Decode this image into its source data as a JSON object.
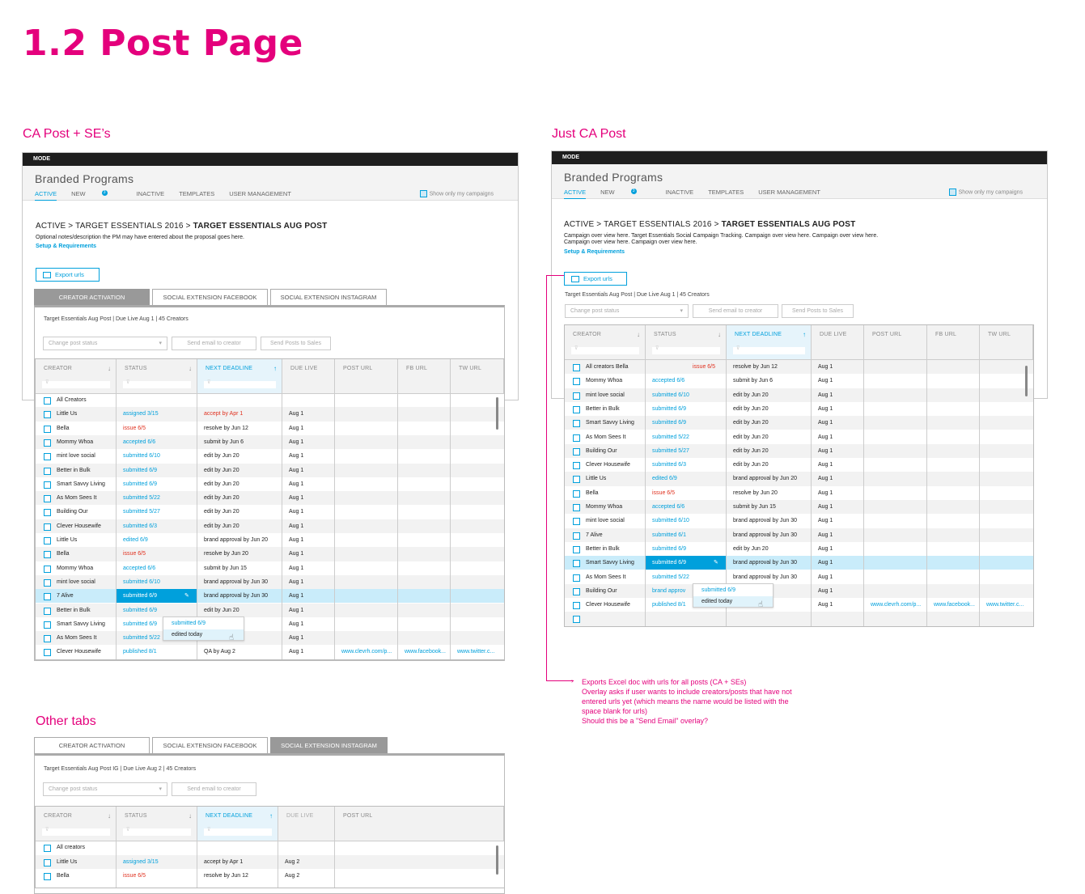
{
  "page_title": "1.2 Post Page",
  "sections": {
    "ca_se": "CA Post + SE’s",
    "just_ca": "Just CA Post",
    "other_tabs": "Other tabs"
  },
  "app": {
    "mode": "MODE",
    "title": "Branded Programs",
    "nav": [
      "ACTIVE",
      "NEW",
      "INACTIVE",
      "TEMPLATES",
      "USER MANAGEMENT"
    ],
    "nav_badge": "3",
    "show_only": "Show only my campaigns"
  },
  "left": {
    "crumb_prefix": "ACTIVE > TARGET ESSENTIALS 2016 > ",
    "crumb_bold": "TARGET ESSENTIALS AUG POST",
    "notes": "Optional notes/description the PM may have entered about the proposal goes here.",
    "setup_link": "Setup & Requirements",
    "export": "Export urls",
    "tabs": [
      "CREATOR ACTIVATION",
      "SOCIAL EXTENSION FACEBOOK",
      "SOCIAL EXTENSION INSTAGRAM"
    ],
    "meta": "Target Essentials Aug Post   |   Due Live Aug 1   |   45 Creators",
    "change_status": "Change post status",
    "send_email": "Send email to creator",
    "send_posts": "Send Posts to Sales",
    "headers": [
      "CREATOR",
      "STATUS",
      "NEXT DEADLINE",
      "DUE LIVE",
      "POST URL",
      "FB URL",
      "TW URL"
    ],
    "rows": [
      {
        "creator": "All Creators",
        "status": "",
        "deadline": "",
        "due": "",
        "post": "",
        "fb": "",
        "tw": ""
      },
      {
        "creator": "Little Us",
        "status": "assigned 3/15",
        "deadline": "accept by Apr 1",
        "due": "Aug 1",
        "post": "",
        "fb": "",
        "tw": ""
      },
      {
        "creator": "Bella",
        "status": "issue 6/5",
        "deadline": "resolve by Jun 12",
        "due": "Aug 1",
        "post": "",
        "fb": "",
        "tw": ""
      },
      {
        "creator": "Mommy Whoa",
        "status": "accepted 6/6",
        "deadline": "submit by Jun 6",
        "due": "Aug 1",
        "post": "",
        "fb": "",
        "tw": ""
      },
      {
        "creator": "mint love social",
        "status": "submitted 6/10",
        "deadline": "edit by Jun 20",
        "due": "Aug 1",
        "post": "",
        "fb": "",
        "tw": ""
      },
      {
        "creator": "Better in Bulk",
        "status": "submitted 6/9",
        "deadline": "edit by Jun 20",
        "due": "Aug 1",
        "post": "",
        "fb": "",
        "tw": ""
      },
      {
        "creator": "Smart Savvy Living",
        "status": "submitted 6/9",
        "deadline": "edit by Jun 20",
        "due": "Aug 1",
        "post": "",
        "fb": "",
        "tw": ""
      },
      {
        "creator": "As Mom Sees It",
        "status": "submitted 5/22",
        "deadline": "edit by Jun 20",
        "due": "Aug 1",
        "post": "",
        "fb": "",
        "tw": ""
      },
      {
        "creator": "Building Our",
        "status": "submitted 5/27",
        "deadline": "edit by Jun 20",
        "due": "Aug 1",
        "post": "",
        "fb": "",
        "tw": ""
      },
      {
        "creator": "Clever Housewife",
        "status": "submitted 6/3",
        "deadline": "edit by Jun 20",
        "due": "Aug 1",
        "post": "",
        "fb": "",
        "tw": ""
      },
      {
        "creator": "Little Us",
        "status": "edited 6/9",
        "deadline": "brand approval by Jun 20",
        "due": "Aug 1",
        "post": "",
        "fb": "",
        "tw": ""
      },
      {
        "creator": "Bella",
        "status": "issue 6/5",
        "deadline": "resolve by Jun 20",
        "due": "Aug 1",
        "post": "",
        "fb": "",
        "tw": ""
      },
      {
        "creator": "Mommy Whoa",
        "status": "accepted 6/6",
        "deadline": "submit by Jun 15",
        "due": "Aug 1",
        "post": "",
        "fb": "",
        "tw": ""
      },
      {
        "creator": "mint love social",
        "status": "submitted 6/10",
        "deadline": "brand approval by Jun 30",
        "due": "Aug 1",
        "post": "",
        "fb": "",
        "tw": ""
      },
      {
        "creator": "7 Alive",
        "status": "submitted 6/9",
        "deadline": "brand approval by Jun 30",
        "due": "Aug 1",
        "post": "",
        "fb": "",
        "tw": ""
      },
      {
        "creator": "Better in Bulk",
        "status": "submitted 6/9",
        "deadline": "edit by Jun 20",
        "due": "Aug 1",
        "post": "",
        "fb": "",
        "tw": ""
      },
      {
        "creator": "Smart Savvy Living",
        "status": "submitted 6/9",
        "deadline": "l by Jun 30",
        "due": "Aug 1",
        "post": "",
        "fb": "",
        "tw": ""
      },
      {
        "creator": "As Mom Sees It",
        "status": "submitted 5/22",
        "deadline": "l by Jun 30",
        "due": "Aug 1",
        "post": "",
        "fb": "",
        "tw": ""
      },
      {
        "creator": "Clever Housewife",
        "status": "published 8/1",
        "deadline": "QA by Aug 2",
        "due": "Aug 1",
        "post": "www.clevrh.com/p...",
        "fb": "www.facebook...",
        "tw": "www.twitter.c..."
      }
    ],
    "popup": {
      "item1": "submitted 6/9",
      "item2": "edited today"
    }
  },
  "right": {
    "crumb_prefix": "ACTIVE > TARGET ESSENTIALS 2016 > ",
    "crumb_bold": "TARGET ESSENTIALS AUG POST",
    "overview1": "Campaign over view here. Target Essentials Social Campaign Tracking. Campaign over view here. Campaign over view here.",
    "overview2": "Campaign over view here. Campaign over view here.",
    "setup_link": "Setup & Requirements",
    "export": "Export urls",
    "meta": "Target Essentials Aug Post   |   Due Live Aug 1   |   45 Creators",
    "change_status": "Change post status",
    "send_email": "Send email to creator",
    "send_posts": "Send Posts to Sales",
    "headers": [
      "CREATOR",
      "STATUS",
      "NEXT DEADLINE",
      "DUE LIVE",
      "POST URL",
      "FB URL",
      "TW URL"
    ],
    "rows": [
      {
        "creator": "All creators    Bella",
        "status": "",
        "statusover": "issue 6/5",
        "deadline": "resolve by Jun 12",
        "due": "Aug 1",
        "post": "",
        "fb": "",
        "tw": ""
      },
      {
        "creator": "Mommy Whoa",
        "status": "accepted 6/6",
        "deadline": "submit by Jun 6",
        "due": "Aug 1",
        "post": "",
        "fb": "",
        "tw": ""
      },
      {
        "creator": "mint love social",
        "status": "submitted 6/10",
        "deadline": "edit by Jun 20",
        "due": "Aug 1",
        "post": "",
        "fb": "",
        "tw": ""
      },
      {
        "creator": "Better in Bulk",
        "status": "submitted 6/9",
        "deadline": "edit by Jun 20",
        "due": "Aug 1",
        "post": "",
        "fb": "",
        "tw": ""
      },
      {
        "creator": "Smart Savvy Living",
        "status": "submitted 6/9",
        "deadline": "edit by Jun 20",
        "due": "Aug 1",
        "post": "",
        "fb": "",
        "tw": ""
      },
      {
        "creator": "As Mom Sees It",
        "status": "submitted 5/22",
        "deadline": "edit by Jun 20",
        "due": "Aug 1",
        "post": "",
        "fb": "",
        "tw": ""
      },
      {
        "creator": "Building Our",
        "status": "submitted 5/27",
        "deadline": "edit by Jun 20",
        "due": "Aug 1",
        "post": "",
        "fb": "",
        "tw": ""
      },
      {
        "creator": "Clever Housewife",
        "status": "submitted 6/3",
        "deadline": "edit by Jun 20",
        "due": "Aug 1",
        "post": "",
        "fb": "",
        "tw": ""
      },
      {
        "creator": "Little Us",
        "status": "edited 6/9",
        "deadline": "brand approval by Jun 20",
        "due": "Aug 1",
        "post": "",
        "fb": "",
        "tw": ""
      },
      {
        "creator": "Bella",
        "status": "issue 6/5",
        "deadline": "resolve by Jun 20",
        "due": "Aug 1",
        "post": "",
        "fb": "",
        "tw": ""
      },
      {
        "creator": "Mommy Whoa",
        "status": "accepted 6/6",
        "deadline": "submit by Jun 15",
        "due": "Aug 1",
        "post": "",
        "fb": "",
        "tw": ""
      },
      {
        "creator": "mint love social",
        "status": "submitted 6/10",
        "deadline": "brand approval by Jun 30",
        "due": "Aug 1",
        "post": "",
        "fb": "",
        "tw": ""
      },
      {
        "creator": "7 Alive",
        "status": "submitted 6/1",
        "deadline": "brand approval by Jun 30",
        "due": "Aug 1",
        "post": "",
        "fb": "",
        "tw": ""
      },
      {
        "creator": "Better in Bulk",
        "status": "submitted 6/9",
        "deadline": "edit by Jun 20",
        "due": "Aug 1",
        "post": "",
        "fb": "",
        "tw": ""
      },
      {
        "creator": "Smart Savvy Living",
        "status": "submitted 6/9",
        "deadline": "brand approval by Jun 30",
        "due": "Aug 1",
        "post": "",
        "fb": "",
        "tw": ""
      },
      {
        "creator": "As Mom Sees It",
        "status": "submitted 5/22",
        "deadline": "brand approval by Jun 30",
        "due": "Aug 1",
        "post": "",
        "fb": "",
        "tw": ""
      },
      {
        "creator": "Building Our",
        "status": "brand approv",
        "deadline": "1",
        "due": "Aug 1",
        "post": "",
        "fb": "",
        "tw": ""
      },
      {
        "creator": "Clever Housewife",
        "status": "published 8/1",
        "deadline": "",
        "due": "Aug 1",
        "post": "www.clevrh.com/p...",
        "fb": "www.facebook...",
        "tw": "www.twitter.c..."
      },
      {
        "creator": "",
        "status": "",
        "deadline": "",
        "due": "",
        "post": "",
        "fb": "",
        "tw": ""
      }
    ],
    "popup": {
      "item1": "submitted 6/9",
      "item2": "edited today"
    }
  },
  "note": {
    "line1": "Exports Excel doc with urls for all posts (CA + SEs)",
    "line2": "Overlay asks if user wants to include creators/posts that have not",
    "line3": "entered urls yet (which means the name would be listed with the",
    "line4": "space blank for urls)",
    "line5": "Should this be a \"Send Email\" overlay?"
  },
  "bottom": {
    "tabs": [
      "CREATOR ACTIVATION",
      "SOCIAL EXTENSION FACEBOOK",
      "SOCIAL EXTENSION INSTAGRAM"
    ],
    "meta": "Target Essentials Aug Post IG   |   Due Live Aug 2   |   45 Creators",
    "change_status": "Change post status",
    "send_email": "Send email to creator",
    "headers": [
      "CREATOR",
      "STATUS",
      "NEXT DEADLINE",
      "DUE LIVE",
      "POST URL"
    ],
    "rows": [
      {
        "creator": "All creators",
        "status": "",
        "deadline": "",
        "due": ""
      },
      {
        "creator": "Little Us",
        "status": "assigned 3/15",
        "deadline": "accept by Apr 1",
        "due": "Aug 2"
      },
      {
        "creator": "Bella",
        "status": "issue 6/5",
        "deadline": "resolve by Jun 12",
        "due": "Aug 2"
      }
    ]
  },
  "colors": {
    "accent": "#e4007c",
    "link": "#00a0dc",
    "error": "#e0301e",
    "dark": "#1e1e1e"
  }
}
